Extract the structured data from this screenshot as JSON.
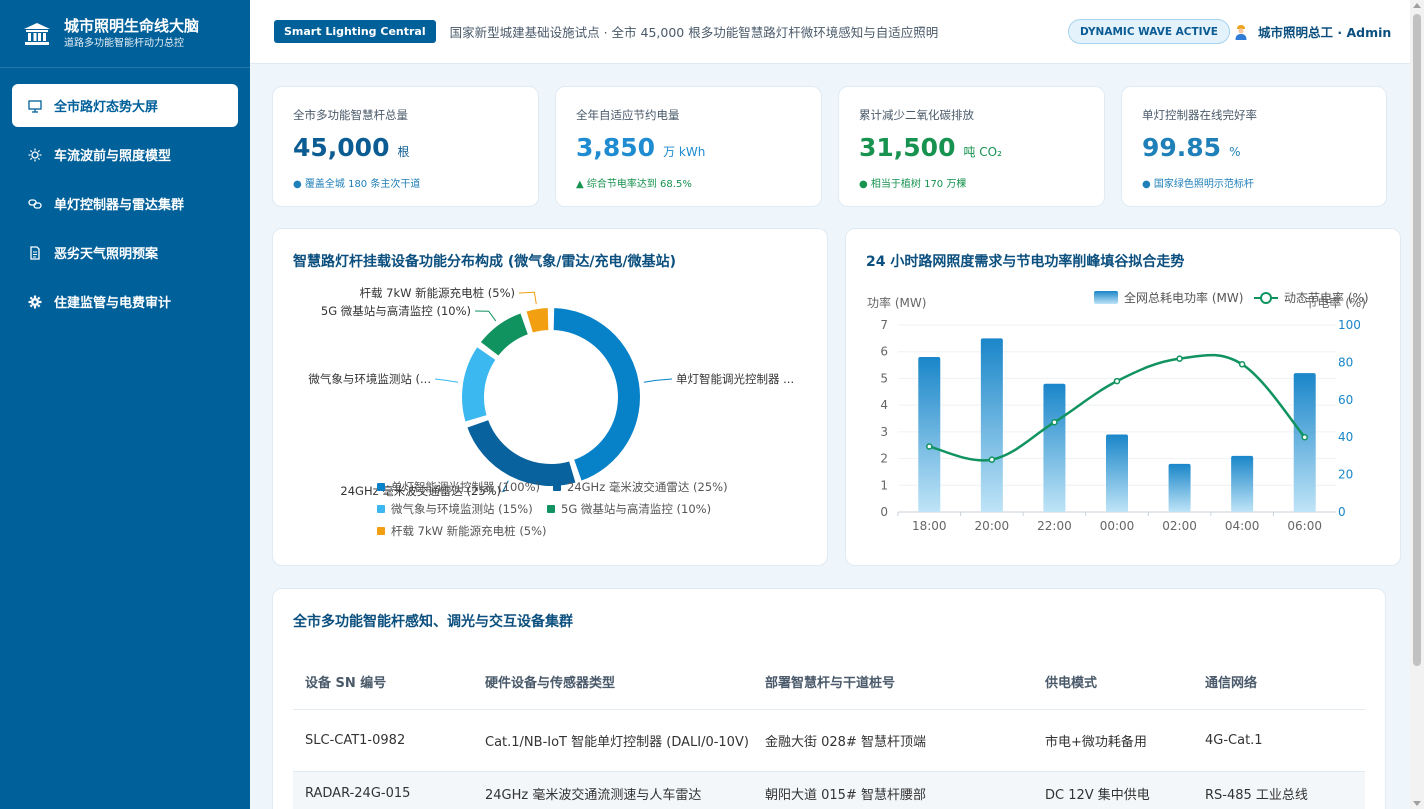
{
  "sidebar": {
    "brand_title": "城市照明生命线大脑",
    "brand_sub": "道路多功能智能杆动力总控",
    "items": [
      {
        "label": "全市路灯态势大屏",
        "icon": "monitor-icon",
        "active": true
      },
      {
        "label": "车流波前与照度模型",
        "icon": "sun-icon"
      },
      {
        "label": "单灯控制器与雷达集群",
        "icon": "link-icon"
      },
      {
        "label": "恶劣天气照明预案",
        "icon": "document-icon"
      },
      {
        "label": "住建监管与电费审计",
        "icon": "gear-icon"
      }
    ]
  },
  "header": {
    "tag": "Smart Lighting Central",
    "desc": "国家新型城建基础设施试点 · 全市 45,000 根多功能智慧路灯杆微环境感知与自适应照明",
    "badge": "DYNAMIC WAVE ACTIVE",
    "user": "城市照明总工 · Admin"
  },
  "kpis": [
    {
      "label": "全市多功能智慧杆总量",
      "value": "45,000",
      "unit": "根",
      "foot": "● 覆盖全城 180 条主次干道",
      "color": "#0b5c93",
      "foot_color": "#1f7fb8"
    },
    {
      "label": "全年自适应节约电量",
      "value": "3,850",
      "unit": "万 kWh",
      "foot": "▲ 综合节电率达到 68.5%",
      "color": "#1f8bd1",
      "foot_color": "#17924f"
    },
    {
      "label": "累计减少二氧化碳排放",
      "value": "31,500",
      "unit": "吨 CO₂",
      "foot": "● 相当于植树 170 万棵",
      "color": "#17924f",
      "foot_color": "#17924f"
    },
    {
      "label": "单灯控制器在线完好率",
      "value": "99.85",
      "unit": "%",
      "foot": "● 国家绿色照明示范标杆",
      "color": "#1f7fb8",
      "foot_color": "#1f7fb8"
    }
  ],
  "donut_panel": {
    "title": "智慧路灯杆挂载设备功能分布构成 (微气象/雷达/充电/微基站)",
    "slices": [
      {
        "name": "单灯智能调光控制器",
        "short": "单灯智能调光控制器 ...",
        "value": 45,
        "color": "#0782c9"
      },
      {
        "name": "24GHz 毫米波交通雷达",
        "short": "24GHz 毫米波交通雷达 (25%)",
        "value": 25,
        "color": "#07629e"
      },
      {
        "name": "微气象与环境监测站",
        "short": "微气象与环境监测站 (...",
        "value": 15,
        "color": "#3bb8ef"
      },
      {
        "name": "5G 微基站与高清监控",
        "short": "5G 微基站与高清监控 (10%)",
        "value": 10,
        "color": "#119360"
      },
      {
        "name": "杆载 7kW 新能源充电桩",
        "short": "杆载 7kW 新能源充电桩 (5%)",
        "value": 5,
        "color": "#f29f12"
      }
    ],
    "legend": [
      {
        "text": "单灯智能调光控制器 (100%)",
        "color": "#0782c9"
      },
      {
        "text": "24GHz 毫米波交通雷达 (25%)",
        "color": "#07629e"
      },
      {
        "text": "微气象与环境监测站 (15%)",
        "color": "#3bb8ef"
      },
      {
        "text": "5G 微基站与高清监控 (10%)",
        "color": "#119360"
      },
      {
        "text": "杆载 7kW 新能源充电桩 (5%)",
        "color": "#f29f12"
      }
    ]
  },
  "chart_data": {
    "type": "bar",
    "title": "24 小时路网照度需求与节电功率削峰填谷拟合走势",
    "categories": [
      "18:00",
      "20:00",
      "22:00",
      "00:00",
      "02:00",
      "04:00",
      "06:00"
    ],
    "ylabel": "功率 (MW)",
    "y2label": "节电率 (%)",
    "ylim": [
      0,
      7
    ],
    "y2lim": [
      0,
      100
    ],
    "yticks": [
      "0",
      "1",
      "2",
      "3",
      "4",
      "5",
      "6",
      "7"
    ],
    "y2ticks": [
      "0",
      "20",
      "40",
      "60",
      "80",
      "100"
    ],
    "legend_position": "top-right",
    "series": [
      {
        "name": "全网总耗电功率 (MW)",
        "type": "bar",
        "values": [
          5.8,
          6.5,
          4.8,
          2.9,
          1.8,
          2.1,
          5.2
        ],
        "color": "#1a8fd0"
      },
      {
        "name": "动态节电率 (%)",
        "type": "line",
        "axis": "right",
        "values": [
          35,
          28,
          48,
          70,
          82,
          79,
          40
        ],
        "color": "#119360"
      }
    ]
  },
  "table": {
    "title": "全市多功能智能杆感知、调光与交互设备集群",
    "headers": [
      "设备 SN 编号",
      "硬件设备与传感器类型",
      "部署智慧杆与干道桩号",
      "供电模式",
      "通信网络"
    ],
    "rows": [
      [
        "SLC-CAT1-0982",
        "Cat.1/NB-IoT 智能单灯控制器 (DALI/0-10V)",
        "金融大街 028# 智慧杆顶端",
        "市电+微功耗备用",
        "4G-Cat.1"
      ],
      [
        "RADAR-24G-015",
        "24GHz 毫米波交通流测速与人车雷达",
        "朝阳大道 015# 智慧杆腰部",
        "DC 12V 集中供电",
        "RS-485 工业总线"
      ]
    ]
  }
}
